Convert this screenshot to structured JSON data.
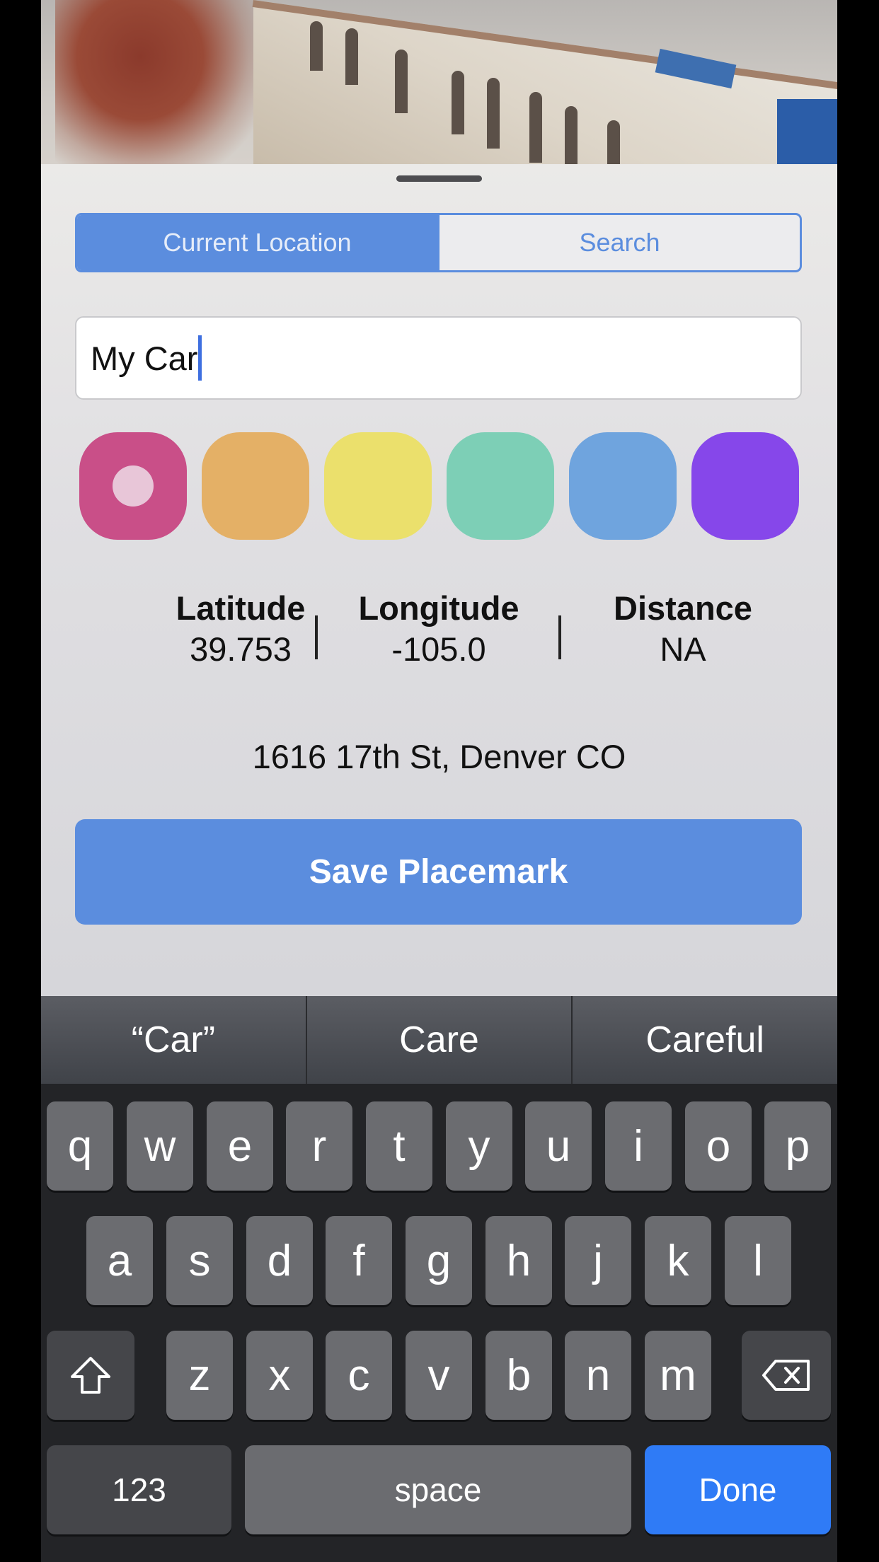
{
  "segments": {
    "current_location": "Current Location",
    "search": "Search"
  },
  "name_field": {
    "value": "My Car"
  },
  "colors": [
    {
      "name": "pink",
      "hex": "#c94f88",
      "selected": true
    },
    {
      "name": "orange",
      "hex": "#e4b066"
    },
    {
      "name": "yellow",
      "hex": "#ebe06c"
    },
    {
      "name": "teal",
      "hex": "#7dcfb6"
    },
    {
      "name": "blue",
      "hex": "#6fa4de"
    },
    {
      "name": "purple",
      "hex": "#8647ea"
    }
  ],
  "stats": {
    "latitude": {
      "label": "Latitude",
      "value": "39.753"
    },
    "longitude": {
      "label": "Longitude",
      "value": "-105.0"
    },
    "distance": {
      "label": "Distance",
      "value": "NA"
    }
  },
  "address": "1616 17th St, Denver CO",
  "save_button": "Save Placemark",
  "keyboard": {
    "suggestions": [
      "“Car”",
      "Care",
      "Careful"
    ],
    "row1": [
      "q",
      "w",
      "e",
      "r",
      "t",
      "y",
      "u",
      "i",
      "o",
      "p"
    ],
    "row2": [
      "a",
      "s",
      "d",
      "f",
      "g",
      "h",
      "j",
      "k",
      "l"
    ],
    "row3": [
      "z",
      "x",
      "c",
      "v",
      "b",
      "n",
      "m"
    ],
    "numbers_key": "123",
    "space_key": "space",
    "done_key": "Done",
    "shift_icon": "shift-arrow-up",
    "delete_icon": "backspace-x"
  }
}
